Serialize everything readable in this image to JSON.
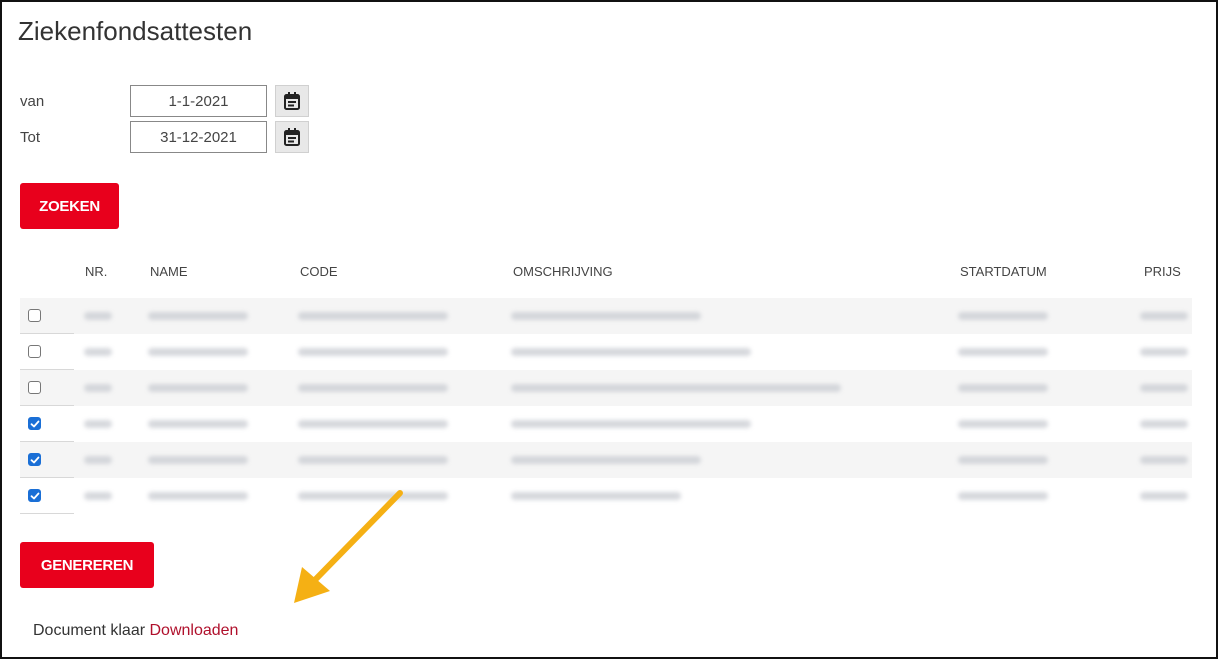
{
  "page": {
    "title": "Ziekenfondsattesten"
  },
  "filters": {
    "from_label": "van",
    "from_value": "1-1-2021",
    "to_label": "Tot",
    "to_value": "31-12-2021"
  },
  "buttons": {
    "search": "ZOEKEN",
    "generate": "GENEREREN"
  },
  "table": {
    "headers": {
      "nr": "NR.",
      "name": "NAME",
      "code": "CODE",
      "description": "OMSCHRIJVING",
      "start_date": "STARTDATUM",
      "price": "PRIJS"
    },
    "rows": [
      {
        "checked": false
      },
      {
        "checked": false
      },
      {
        "checked": false
      },
      {
        "checked": true
      },
      {
        "checked": true
      },
      {
        "checked": true
      }
    ]
  },
  "status": {
    "text": "Document klaar",
    "link": "Downloaden"
  },
  "colors": {
    "accent_red": "#e8001c",
    "link_red": "#b0102c",
    "checkbox_blue": "#1a6fd6",
    "annotation_arrow": "#f5b014"
  },
  "icons": {
    "calendar": "calendar-icon",
    "checkmark": "checkmark-icon",
    "arrow": "annotation-arrow-icon"
  }
}
